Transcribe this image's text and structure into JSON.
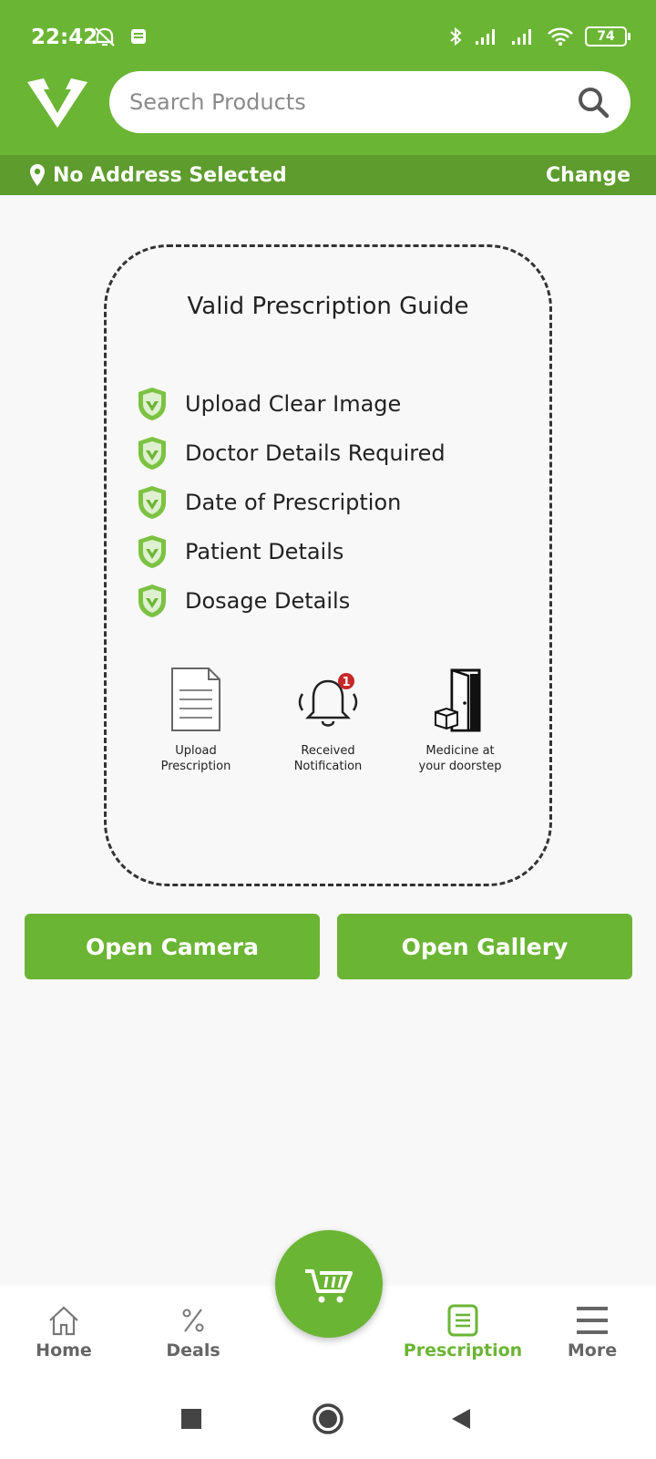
{
  "status": {
    "time": "22:42",
    "battery": "74"
  },
  "search": {
    "placeholder": "Search Products"
  },
  "address": {
    "text": "No Address Selected",
    "change_label": "Change"
  },
  "guide": {
    "title": "Valid Prescription Guide",
    "items": [
      "Upload Clear Image",
      "Doctor Details Required",
      "Date of Prescription",
      "Patient Details",
      "Dosage Details"
    ],
    "steps": [
      {
        "line1": "Upload",
        "line2": "Prescription"
      },
      {
        "line1": "Received",
        "line2": "Notification"
      },
      {
        "line1": "Medicine at",
        "line2": "your doorstep"
      }
    ],
    "notification_count": "1"
  },
  "buttons": {
    "camera": "Open Camera",
    "gallery": "Open Gallery"
  },
  "nav": {
    "home": "Home",
    "deals": "Deals",
    "prescription": "Prescription",
    "more": "More"
  },
  "colors": {
    "brand_green": "#6bb535",
    "address_bar": "#5d9c2d"
  }
}
